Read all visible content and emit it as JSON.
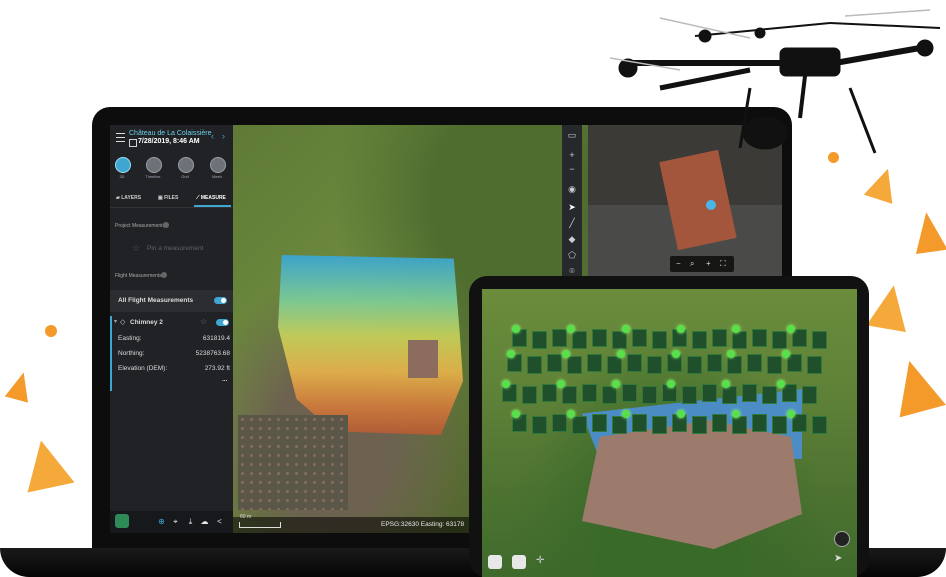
{
  "colors": {
    "accent": "#3ea6d0",
    "orange": "#f39a2b",
    "sidebar": "#202226"
  },
  "sidebar": {
    "site_name": "Château de La Colaissière",
    "datetime": "7/28/2019, 8:46 AM",
    "tools": [
      {
        "label": "3D",
        "icon": "cube-icon"
      },
      {
        "label": "Timeline",
        "icon": "timeline-icon"
      },
      {
        "label": "Grid",
        "icon": "grid-icon"
      },
      {
        "label": "Mesh",
        "icon": "mesh-icon"
      }
    ],
    "tabs": [
      {
        "label": "LAYERS",
        "icon": "layers-icon"
      },
      {
        "label": "FILES",
        "icon": "files-icon"
      },
      {
        "label": "MEASURE",
        "icon": "ruler-icon"
      }
    ],
    "project_measurements_label": "Project Measurements",
    "pin_placeholder": "Pin a measurement",
    "flight_measurements_label": "Flight Measurements",
    "all_flight_label": "All Flight Measurements",
    "measurement": {
      "name": "Chimney 2",
      "rows": [
        {
          "label": "Easting:",
          "value": "631819.4"
        },
        {
          "label": "Northing:",
          "value": "5238763.68"
        },
        {
          "label": "Elevation (DEM):",
          "value": "273.92 ft"
        }
      ],
      "more": "..."
    }
  },
  "map": {
    "epsg_text": "EPSG:32630 Easting: 63178",
    "scale_text": "60 m"
  }
}
